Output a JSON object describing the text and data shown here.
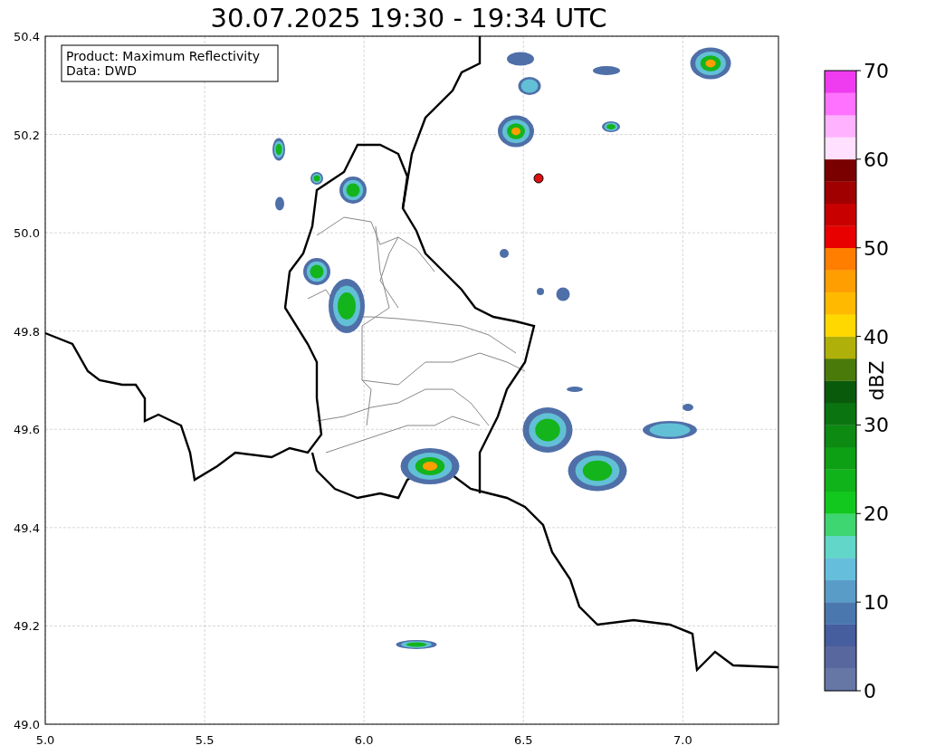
{
  "title": "30.07.2025 19:30 - 19:34 UTC",
  "legend": [
    "Product: Maximum Reflectivity",
    "Data: DWD"
  ],
  "x_axis": {
    "ticks": [
      "5.0",
      "5.5",
      "6.0",
      "6.5",
      "7.0"
    ]
  },
  "y_axis": {
    "ticks": [
      "50.4",
      "50.2",
      "50.0",
      "49.8",
      "49.6",
      "49.4",
      "49.2",
      "49.0"
    ]
  },
  "colorbar": {
    "label": "dBZ",
    "ticks": [
      "70",
      "60",
      "50",
      "40",
      "30",
      "20",
      "10",
      "0"
    ],
    "bands": [
      {
        "color": "#6677a6"
      },
      {
        "color": "#58689e"
      },
      {
        "color": "#465d9e"
      },
      {
        "color": "#4a78ae"
      },
      {
        "color": "#5a9cc8"
      },
      {
        "color": "#64bedc"
      },
      {
        "color": "#62d6c8"
      },
      {
        "color": "#3ed670"
      },
      {
        "color": "#12c81e"
      },
      {
        "color": "#10b41a"
      },
      {
        "color": "#0ea014"
      },
      {
        "color": "#0c8a12"
      },
      {
        "color": "#0a7410"
      },
      {
        "color": "#0a5a0c"
      },
      {
        "color": "#4a7a0a"
      },
      {
        "color": "#b0b00a"
      },
      {
        "color": "#ffd800"
      },
      {
        "color": "#ffba00"
      },
      {
        "color": "#ff9e00"
      },
      {
        "color": "#ff7e00"
      },
      {
        "color": "#e80000"
      },
      {
        "color": "#c80000"
      },
      {
        "color": "#a00000"
      },
      {
        "color": "#7a0000"
      },
      {
        "color": "#ffe0ff"
      },
      {
        "color": "#ffb2ff"
      },
      {
        "color": "#ff72ff"
      },
      {
        "color": "#f03cf0"
      }
    ]
  }
}
